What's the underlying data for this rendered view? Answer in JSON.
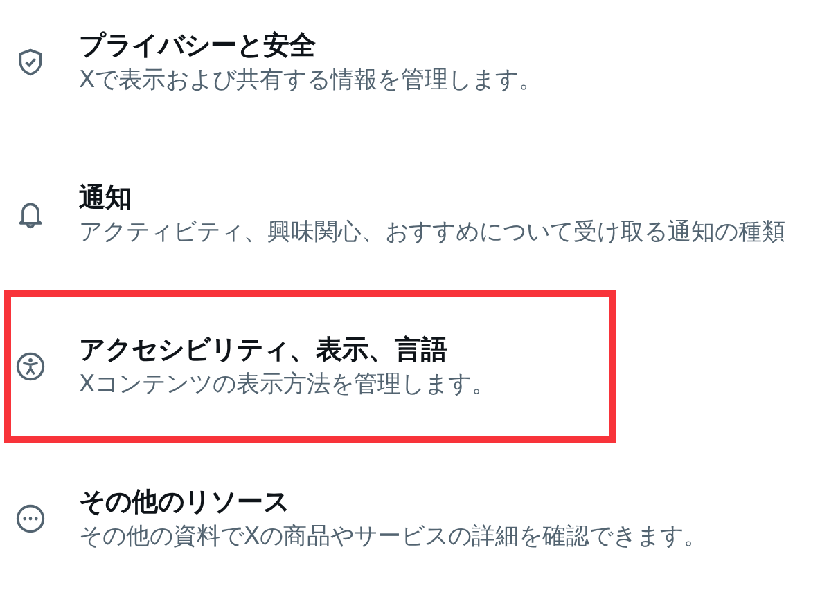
{
  "settings_items": [
    {
      "kind": "shield",
      "title": "プライバシーと安全",
      "description": "Xで表示および共有する情報を管理します。",
      "highlighted": false
    },
    {
      "kind": "bell",
      "title": "通知",
      "description": "アクティビティ、興味関心、おすすめについて受け取る通知の種類",
      "highlighted": false
    },
    {
      "kind": "accessibility",
      "title": "アクセシビリティ、表示、言語",
      "description": "Xコンテンツの表示方法を管理します。",
      "highlighted": true
    },
    {
      "kind": "more",
      "title": "その他のリソース",
      "description": "その他の資料でXの商品やサービスの詳細を確認できます。",
      "highlighted": false
    }
  ]
}
